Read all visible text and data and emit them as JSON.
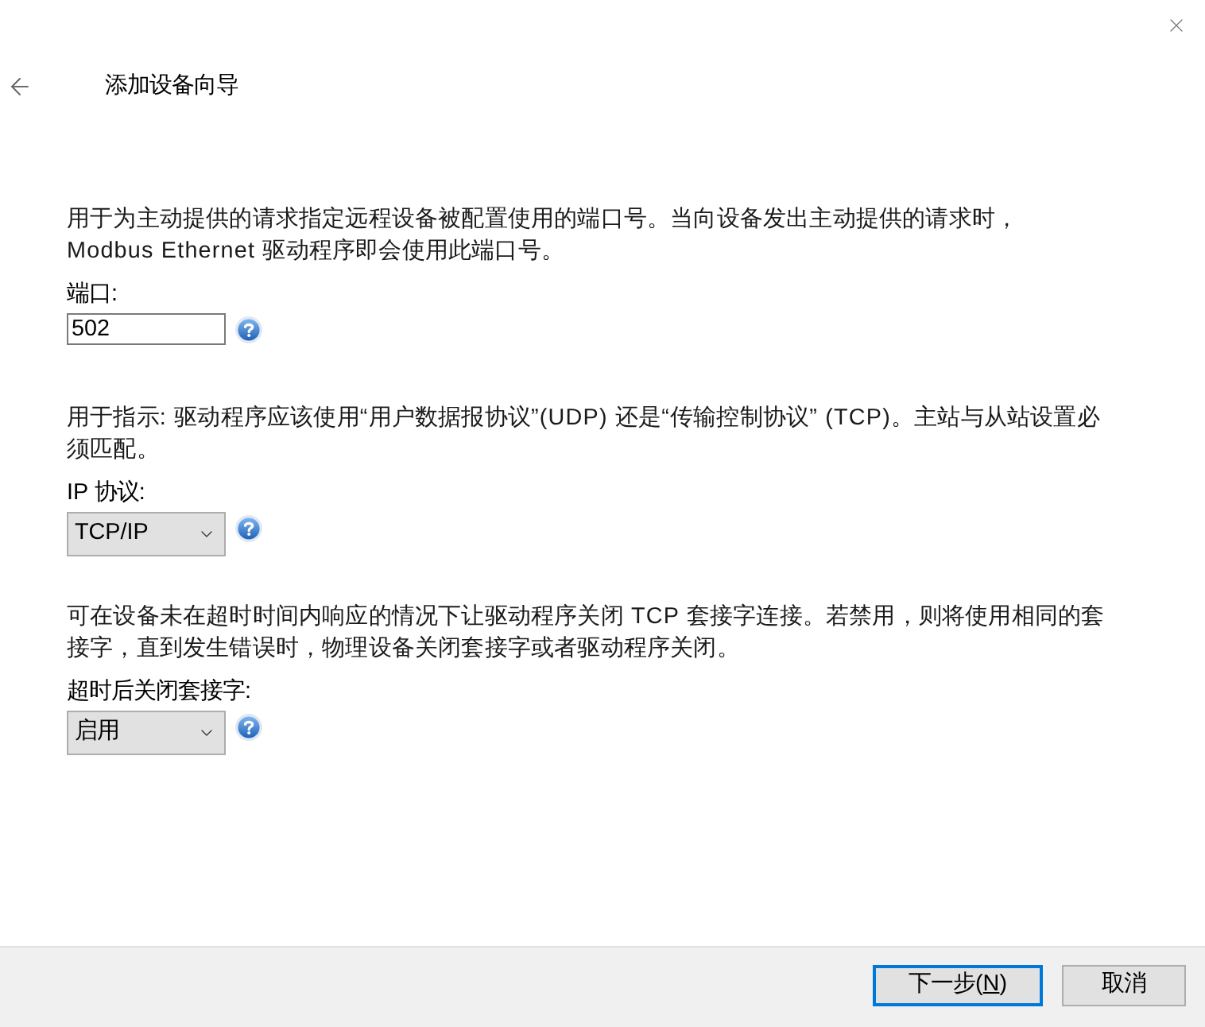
{
  "window": {
    "title": "添加设备向导"
  },
  "sections": [
    {
      "description": "用于为主动提供的请求指定远程设备被配置使用的端口号。当向设备发出主动提供的请求时，Modbus Ethernet 驱动程序即会使用此端口号。",
      "label": "端口:",
      "field": {
        "kind": "text",
        "value": "502"
      }
    },
    {
      "description": "用于指示: 驱动程序应该使用“用户数据报协议”(UDP) 还是“传输控制协议” (TCP)。主站与从站设置必须匹配。",
      "label": "IP 协议:",
      "field": {
        "kind": "dropdown",
        "value": "TCP/IP"
      }
    },
    {
      "description": "可在设备未在超时时间内响应的情况下让驱动程序关闭 TCP 套接字连接。若禁用，则将使用相同的套接字，直到发生错误时，物理设备关闭套接字或者驱动程序关闭。",
      "label": "超时后关闭套接字:",
      "field": {
        "kind": "dropdown",
        "value": "启用"
      }
    }
  ],
  "buttons": [
    {
      "label": "下一步(",
      "access_key": "N",
      "label_tail": ")",
      "default": true
    },
    {
      "label": "取消",
      "default": false
    }
  ]
}
